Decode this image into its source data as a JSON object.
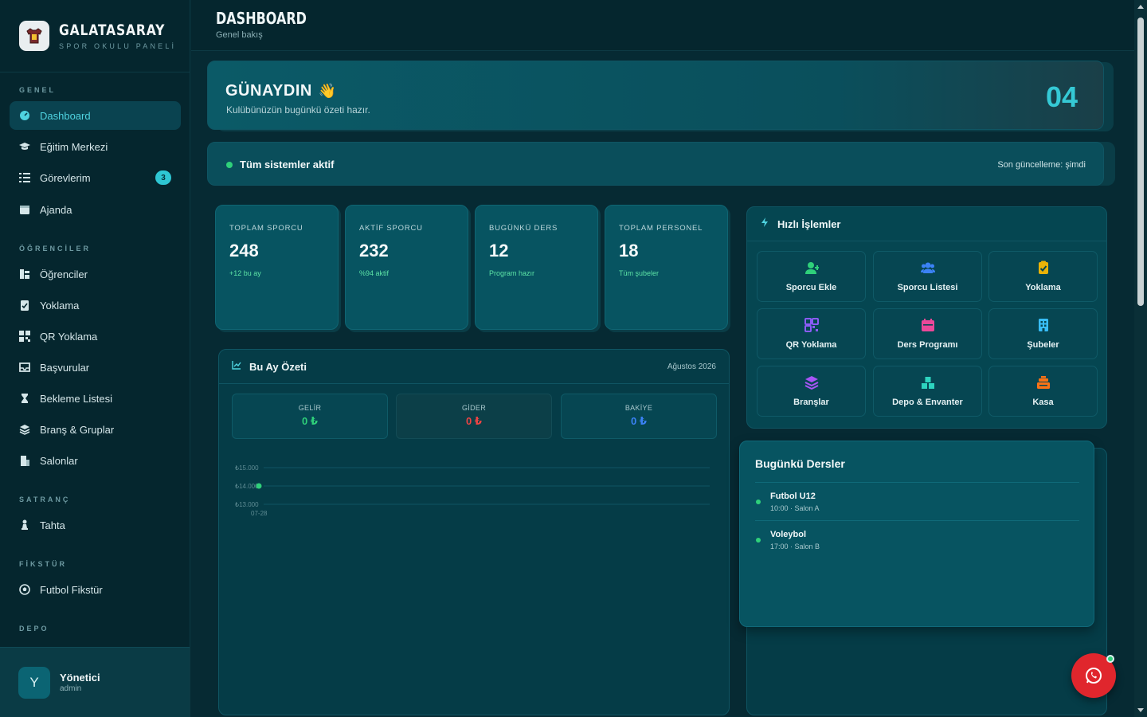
{
  "brand": {
    "title": "GALATASARAY",
    "subtitle": "SPOR OKULU PANELİ"
  },
  "sidebar": {
    "sections": {
      "genel": "GENEL",
      "ogrenciler": "ÖĞRENCİLER",
      "satranc": "SATRANÇ",
      "fikstur": "FİKSTÜR",
      "depo": "DEPO"
    },
    "items": [
      {
        "label": "Dashboard",
        "icon": "dashboard-icon"
      },
      {
        "label": "Eğitim Merkezi",
        "icon": "graduation-cap-icon"
      },
      {
        "label": "Görevlerim",
        "icon": "task-list-icon",
        "badge": "3"
      },
      {
        "label": "Ajanda",
        "icon": "calendar-icon"
      },
      {
        "label": "Öğrenciler",
        "icon": "students-icon"
      },
      {
        "label": "Yoklama",
        "icon": "clipboard-check-icon"
      },
      {
        "label": "QR Yoklama",
        "icon": "qr-code-icon"
      },
      {
        "label": "Başvurular",
        "icon": "inbox-icon"
      },
      {
        "label": "Bekleme Listesi",
        "icon": "hourglass-icon"
      },
      {
        "label": "Branş & Gruplar",
        "icon": "layers-icon"
      },
      {
        "label": "Salonlar",
        "icon": "building-icon"
      },
      {
        "label": "Tahta",
        "icon": "chess-piece-icon"
      },
      {
        "label": "Futbol Fikstür",
        "icon": "football-icon"
      }
    ]
  },
  "user": {
    "initial": "Y",
    "name": "Yönetici",
    "role": "admin"
  },
  "header": {
    "title": "DASHBOARD",
    "subtitle": "Genel bakış"
  },
  "welcome": {
    "title": "GÜNAYDIN",
    "emoji": "👋",
    "subtitle": "Kulübünüzün bugünkü özeti hazır.",
    "day": "04"
  },
  "status": {
    "text": "Tüm sistemler aktif",
    "updated": "Son güncelleme: şimdi"
  },
  "stats": [
    {
      "label": "TOPLAM SPORCU",
      "value": "248",
      "note": "+12 bu ay"
    },
    {
      "label": "AKTİF SPORCU",
      "value": "232",
      "note": "%94 aktif"
    },
    {
      "label": "BUGÜNKÜ DERS",
      "value": "12",
      "note": "Program hazır"
    },
    {
      "label": "TOPLAM PERSONEL",
      "value": "18",
      "note": "Tüm şubeler"
    }
  ],
  "summary": {
    "title": "Bu Ay Özeti",
    "month": "Ağustos 2026",
    "income": {
      "label": "GELİR",
      "value": "0 ₺",
      "color": "#2fd07a"
    },
    "expense": {
      "label": "GİDER",
      "value": "0 ₺",
      "color": "#ef4444"
    },
    "balance": {
      "label": "BAKİYE",
      "value": "0 ₺",
      "color": "#3b82f6"
    }
  },
  "chart_data": {
    "type": "line",
    "x": [
      "07-28"
    ],
    "series": [
      {
        "values": [
          14000
        ]
      }
    ],
    "yticks": [
      "₺15.000",
      "₺14.000",
      "₺13.000"
    ],
    "ylim": [
      13000,
      15000
    ],
    "grid": true,
    "color": "#2fd07a"
  },
  "quick_actions": {
    "title": "Hızlı İşlemler",
    "items": [
      {
        "label": "Sporcu Ekle",
        "icon": "user-plus-icon",
        "color": "#2fd07a"
      },
      {
        "label": "Sporcu Listesi",
        "icon": "users-icon",
        "color": "#3b82f6"
      },
      {
        "label": "Yoklama",
        "icon": "clipboard-check-icon",
        "color": "#eab308"
      },
      {
        "label": "QR Yoklama",
        "icon": "qr-code-icon",
        "color": "#8b5cf6"
      },
      {
        "label": "Ders Programı",
        "icon": "calendar-icon",
        "color": "#ec4899"
      },
      {
        "label": "Şubeler",
        "icon": "building-icon",
        "color": "#38bdf8"
      },
      {
        "label": "Branşlar",
        "icon": "layers-icon",
        "color": "#a855f7"
      },
      {
        "label": "Depo & Envanter",
        "icon": "boxes-icon",
        "color": "#2dd4bf"
      },
      {
        "label": "Kasa",
        "icon": "cash-register-icon",
        "color": "#f97316"
      }
    ]
  },
  "lessons": {
    "title": "Bugünkü Dersler",
    "items": [
      {
        "name": "Futbol U12",
        "meta": "10:00 · Salon A"
      },
      {
        "name": "Voleybol",
        "meta": "17:00 · Salon B"
      }
    ]
  },
  "colors": {
    "accent": "#2ec6d3",
    "success": "#2fd07a",
    "danger": "#e0262d"
  }
}
